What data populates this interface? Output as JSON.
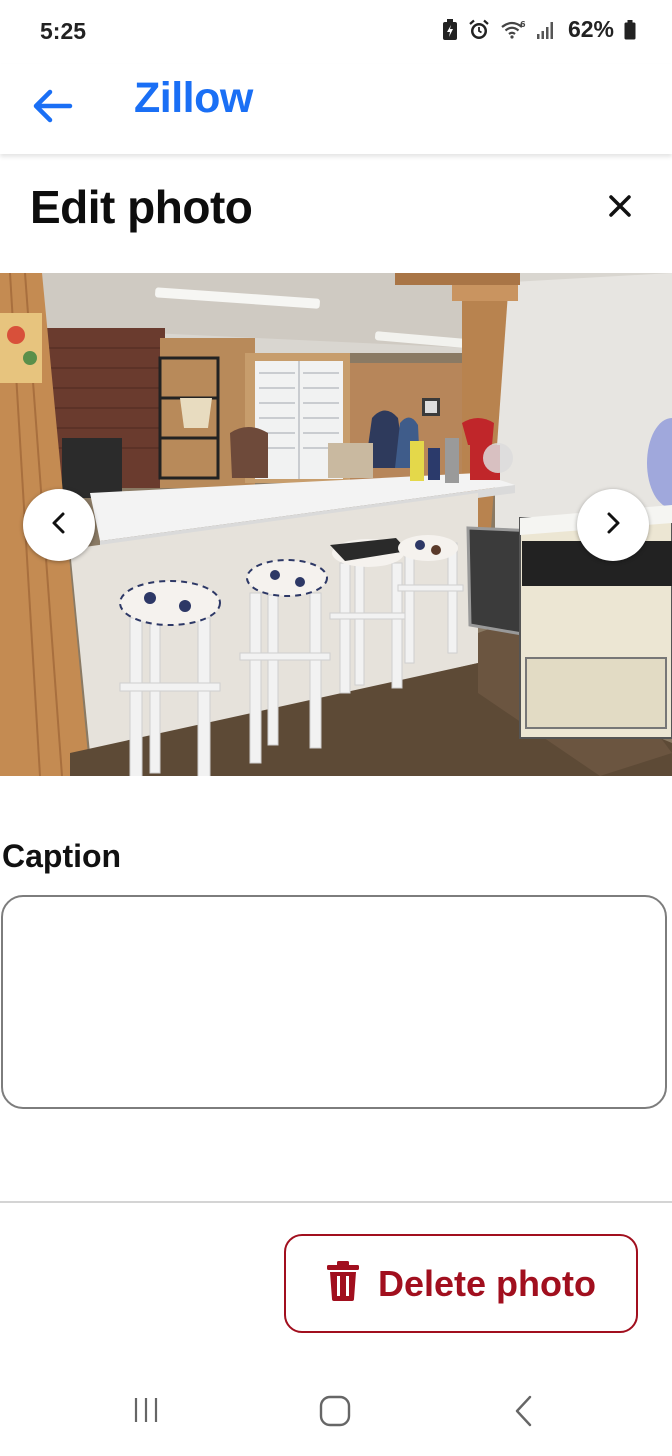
{
  "status_bar": {
    "time": "5:25",
    "battery": "62%",
    "icons": [
      "battery-saver-icon",
      "alarm-icon",
      "wifi-icon",
      "signal-icon",
      "battery-icon"
    ]
  },
  "app_bar": {
    "title": "Zillow",
    "back_icon": "arrow-left-icon",
    "accent_color": "#1a6ff5"
  },
  "dialog": {
    "title": "Edit photo",
    "close_icon": "close-icon"
  },
  "photo": {
    "prev_icon": "chevron-left-icon",
    "next_icon": "chevron-right-icon"
  },
  "caption": {
    "label": "Caption",
    "value": "",
    "placeholder": ""
  },
  "delete": {
    "label": "Delete photo",
    "icon": "trash-icon",
    "color": "#a10f1e"
  },
  "system_nav": {
    "icons": [
      "recent-apps-icon",
      "home-icon",
      "system-back-icon"
    ]
  }
}
